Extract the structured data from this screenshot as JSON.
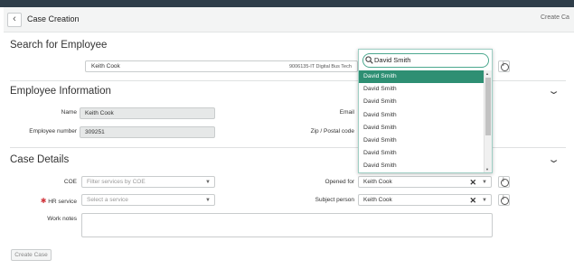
{
  "header": {
    "title": "Case Creation",
    "right_label": "Create Ca"
  },
  "search_section": {
    "title": "Search for Employee",
    "employee_value": "Keith Cook",
    "employee_detail": "9006135-IT Digital Bus Tech"
  },
  "dropdown": {
    "search_value": "David Smith",
    "options": [
      "David Smith",
      "David Smith",
      "David Smith",
      "David Smith",
      "David Smith",
      "David Smith",
      "David Smith",
      "David Smith"
    ]
  },
  "employee_info": {
    "title": "Employee Information",
    "name_label": "Name",
    "name_value": "Keith Cook",
    "empnum_label": "Employee number",
    "empnum_value": "309251",
    "email_label": "Email",
    "zip_label": "Zip / Postal code"
  },
  "case_details": {
    "title": "Case Details",
    "coe_label": "COE",
    "coe_placeholder": "Filter services by COE",
    "hr_label": "HR service",
    "hr_placeholder": "Select a service",
    "opened_label": "Opened for",
    "opened_value": "Keith Cook",
    "subject_label": "Subject person",
    "subject_value": "Keith Cook",
    "worknotes_label": "Work notes",
    "create_label": "Create Case"
  }
}
